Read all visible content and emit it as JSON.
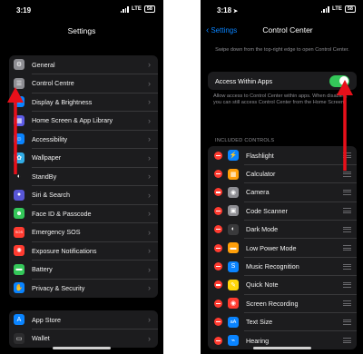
{
  "left": {
    "status": {
      "time": "3:19",
      "network": "LTE",
      "battery": "58"
    },
    "title": "Settings",
    "group1": [
      {
        "label": "General",
        "icon": "gear-icon",
        "color": "#8e8e93",
        "glyph": "⚙"
      },
      {
        "label": "Control Centre",
        "icon": "control-centre-icon",
        "color": "#8e8e93",
        "glyph": "☰"
      },
      {
        "label": "Display & Brightness",
        "icon": "brightness-icon",
        "color": "#0a84ff",
        "glyph": "☀"
      },
      {
        "label": "Home Screen & App Library",
        "icon": "home-screen-icon",
        "color": "#5e5ce6",
        "glyph": "▦"
      },
      {
        "label": "Accessibility",
        "icon": "accessibility-icon",
        "color": "#0a84ff",
        "glyph": "☺"
      },
      {
        "label": "Wallpaper",
        "icon": "wallpaper-icon",
        "color": "#32ade6",
        "glyph": "✿"
      },
      {
        "label": "StandBy",
        "icon": "standby-icon",
        "color": "#1c1c1e",
        "glyph": "◐"
      },
      {
        "label": "Siri & Search",
        "icon": "siri-icon",
        "color": "#5856d6",
        "glyph": "●"
      },
      {
        "label": "Face ID & Passcode",
        "icon": "face-id-icon",
        "color": "#34c759",
        "glyph": "☻"
      },
      {
        "label": "Emergency SOS",
        "icon": "sos-icon",
        "color": "#ff3b30",
        "glyph": "SOS"
      },
      {
        "label": "Exposure Notifications",
        "icon": "exposure-icon",
        "color": "#ff3b30",
        "glyph": "✺"
      },
      {
        "label": "Battery",
        "icon": "battery-icon",
        "color": "#34c759",
        "glyph": "▬"
      },
      {
        "label": "Privacy & Security",
        "icon": "privacy-hand-icon",
        "color": "#0a84ff",
        "glyph": "✋"
      }
    ],
    "group2": [
      {
        "label": "App Store",
        "icon": "app-store-icon",
        "color": "#0a84ff",
        "glyph": "A"
      },
      {
        "label": "Wallet",
        "icon": "wallet-icon",
        "color": "#2c2c2e",
        "glyph": "▭"
      }
    ]
  },
  "right": {
    "status": {
      "time": "3:18",
      "network": "LTE",
      "battery": "58"
    },
    "back_label": "Settings",
    "title": "Control Center",
    "intro": "Swipe down from the top-right edge to open Control Center.",
    "allow_label": "Access Within Apps",
    "allow_on": true,
    "allow_desc": "Allow access to Control Center within apps. When disabled, you can still access Control Center from the Home Screen.",
    "section_header": "INCLUDED CONTROLS",
    "controls": [
      {
        "label": "Flashlight",
        "icon": "flashlight-icon",
        "color": "#0a84ff",
        "glyph": "⚡"
      },
      {
        "label": "Calculator",
        "icon": "calculator-icon",
        "color": "#ff9f0a",
        "glyph": "▦"
      },
      {
        "label": "Camera",
        "icon": "camera-icon",
        "color": "#8e8e93",
        "glyph": "◉"
      },
      {
        "label": "Code Scanner",
        "icon": "code-scanner-icon",
        "color": "#8e8e93",
        "glyph": "▣"
      },
      {
        "label": "Dark Mode",
        "icon": "dark-mode-icon",
        "color": "#3a3a3c",
        "glyph": "◐"
      },
      {
        "label": "Low Power Mode",
        "icon": "low-power-icon",
        "color": "#ff9f0a",
        "glyph": "▬"
      },
      {
        "label": "Music Recognition",
        "icon": "music-recognition-icon",
        "color": "#0a84ff",
        "glyph": "S"
      },
      {
        "label": "Quick Note",
        "icon": "quick-note-icon",
        "color": "#ffd60a",
        "glyph": "✎"
      },
      {
        "label": "Screen Recording",
        "icon": "screen-recording-icon",
        "color": "#ff3b30",
        "glyph": "◉"
      },
      {
        "label": "Text Size",
        "icon": "text-size-icon",
        "color": "#0a84ff",
        "glyph": "aA"
      },
      {
        "label": "Hearing",
        "icon": "hearing-icon",
        "color": "#0a84ff",
        "glyph": "⌁"
      }
    ]
  }
}
